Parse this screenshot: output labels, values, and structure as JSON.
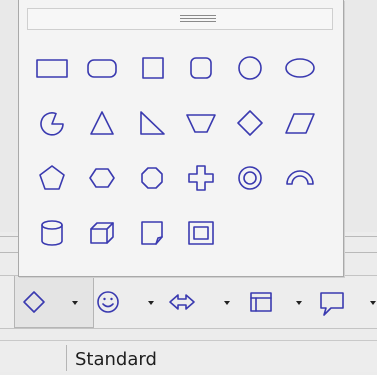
{
  "palette": {
    "shapes": [
      "rectangle-icon",
      "rounded-rectangle-icon",
      "square-icon",
      "rounded-square-icon",
      "circle-icon",
      "ellipse-icon",
      "circle-pie-icon",
      "isosceles-triangle-icon",
      "right-triangle-icon",
      "trapezoid-icon",
      "diamond-icon",
      "parallelogram-icon",
      "pentagon-icon",
      "hexagon-icon",
      "octagon-icon",
      "cross-icon",
      "ring-icon",
      "block-arc-icon",
      "cylinder-icon",
      "cube-icon",
      "folded-corner-icon",
      "frame-icon"
    ]
  },
  "toolbar": {
    "buttons": [
      "basic-shapes-icon",
      "symbol-shapes-icon",
      "block-arrows-icon",
      "flowchart-icon",
      "callouts-icon"
    ]
  },
  "status": {
    "style": "Standard"
  },
  "colors": {
    "shape_stroke": "#3a3ab0",
    "popup_bg": "#f4f4f4"
  }
}
